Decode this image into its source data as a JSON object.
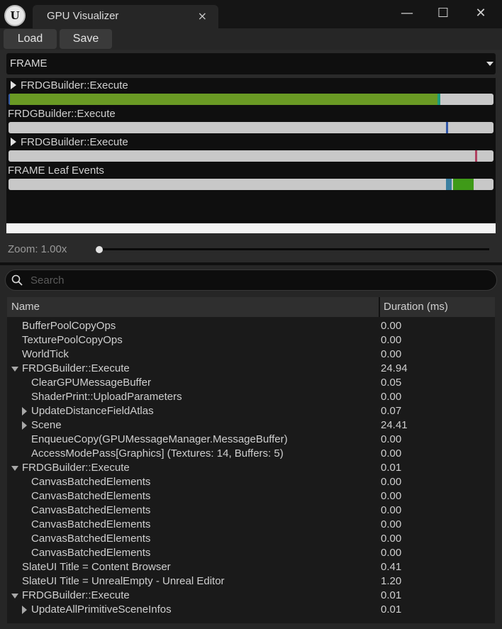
{
  "window": {
    "logo_text": "U",
    "tab_title": "GPU Visualizer",
    "tab_close": "×",
    "minimize": "—",
    "maximize": "☐",
    "close": "✕"
  },
  "toolbar": {
    "load_label": "Load",
    "save_label": "Save"
  },
  "frame_selector": {
    "value": "FRAME"
  },
  "timeline": {
    "tracks": [
      {
        "label": "FRDGBuilder::Execute",
        "expandable": true
      },
      {
        "label": "FRDGBuilder::Execute",
        "expandable": false
      },
      {
        "label": "FRDGBuilder::Execute",
        "expandable": true
      },
      {
        "label": "FRAME Leaf Events",
        "expandable": false
      }
    ],
    "colors": {
      "green": "#6a9a24",
      "teal": "#1e9c7c",
      "blue": "#2f55a8",
      "red": "#b04060",
      "track": "#c8c8c8"
    }
  },
  "zoom": {
    "label": "Zoom: 1.00x",
    "value": 1.0
  },
  "search": {
    "placeholder": "Search"
  },
  "tree": {
    "columns": {
      "name": "Name",
      "duration": "Duration (ms)"
    },
    "rows": [
      {
        "name": "BufferPoolCopyOps",
        "duration": "0.00",
        "depth": 0,
        "expander": "none"
      },
      {
        "name": "TexturePoolCopyOps",
        "duration": "0.00",
        "depth": 0,
        "expander": "none"
      },
      {
        "name": "WorldTick",
        "duration": "0.00",
        "depth": 0,
        "expander": "none"
      },
      {
        "name": "FRDGBuilder::Execute",
        "duration": "24.94",
        "depth": 0,
        "expander": "open"
      },
      {
        "name": "ClearGPUMessageBuffer",
        "duration": "0.05",
        "depth": 1,
        "expander": "none"
      },
      {
        "name": "ShaderPrint::UploadParameters",
        "duration": "0.00",
        "depth": 1,
        "expander": "none"
      },
      {
        "name": "UpdateDistanceFieldAtlas",
        "duration": "0.07",
        "depth": 1,
        "expander": "closed"
      },
      {
        "name": "Scene",
        "duration": "24.41",
        "depth": 1,
        "expander": "closed"
      },
      {
        "name": "EnqueueCopy(GPUMessageManager.MessageBuffer)",
        "duration": "0.00",
        "depth": 1,
        "expander": "none"
      },
      {
        "name": "AccessModePass[Graphics] (Textures: 14, Buffers: 5)",
        "duration": "0.00",
        "depth": 1,
        "expander": "none"
      },
      {
        "name": "FRDGBuilder::Execute",
        "duration": "0.01",
        "depth": 0,
        "expander": "open"
      },
      {
        "name": "CanvasBatchedElements",
        "duration": "0.00",
        "depth": 1,
        "expander": "none"
      },
      {
        "name": "CanvasBatchedElements",
        "duration": "0.00",
        "depth": 1,
        "expander": "none"
      },
      {
        "name": "CanvasBatchedElements",
        "duration": "0.00",
        "depth": 1,
        "expander": "none"
      },
      {
        "name": "CanvasBatchedElements",
        "duration": "0.00",
        "depth": 1,
        "expander": "none"
      },
      {
        "name": "CanvasBatchedElements",
        "duration": "0.00",
        "depth": 1,
        "expander": "none"
      },
      {
        "name": "CanvasBatchedElements",
        "duration": "0.00",
        "depth": 1,
        "expander": "none"
      },
      {
        "name": "SlateUI Title = Content Browser",
        "duration": "0.41",
        "depth": 0,
        "expander": "none"
      },
      {
        "name": "SlateUI Title = UnrealEmpty - Unreal Editor",
        "duration": "1.20",
        "depth": 0,
        "expander": "none"
      },
      {
        "name": "FRDGBuilder::Execute",
        "duration": "0.01",
        "depth": 0,
        "expander": "open"
      },
      {
        "name": "UpdateAllPrimitiveSceneInfos",
        "duration": "0.01",
        "depth": 1,
        "expander": "closed"
      }
    ]
  }
}
